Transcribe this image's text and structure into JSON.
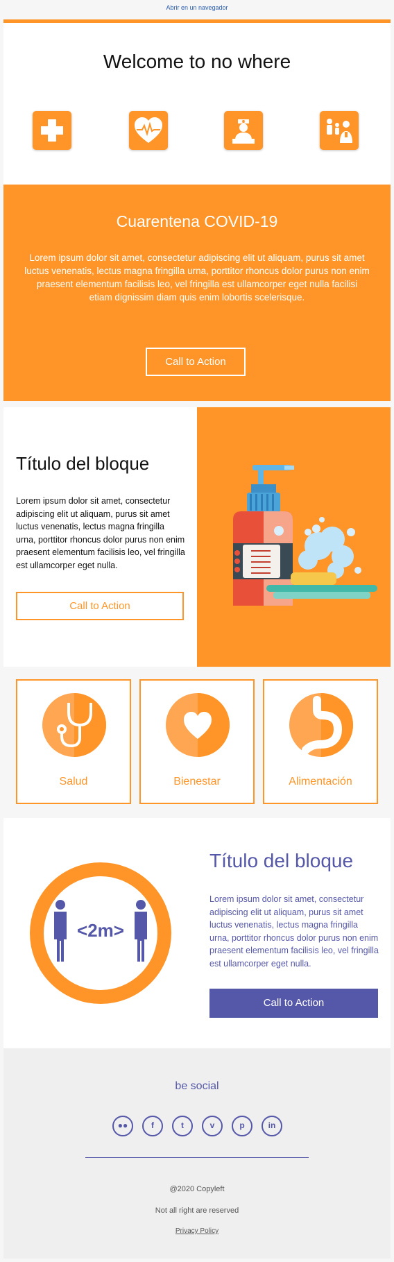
{
  "topbar": {
    "open_link": "Abrir en un navegador"
  },
  "header": {
    "title": "Welcome to no where",
    "icons": [
      "medical-cross-icon",
      "heart-pulse-icon",
      "nurse-icon",
      "family-doctor-icon"
    ]
  },
  "covid": {
    "title": "Cuarentena COVID-19",
    "body": "Lorem ipsum dolor sit amet, consectetur adipiscing elit ut aliquam, purus sit amet luctus venenatis, lectus magna fringilla urna, porttitor rhoncus dolor purus non enim praesent elementum facilisis leo, vel fringilla est ullamcorper eget nulla facilisi etiam dignissim diam quis enim lobortis scelerisque.",
    "cta": "Call to Action"
  },
  "block1": {
    "title": "Título del bloque",
    "body": "Lorem ipsum dolor sit amet, consectetur adipiscing elit ut aliquam, purus sit amet luctus venenatis, lectus magna fringilla urna, porttitor rhoncus dolor purus non enim praesent elementum facilisis leo, vel fringilla est ullamcorper eget nulla.",
    "cta": "Call to Action",
    "image": "soap-bottle-illustration"
  },
  "cards": [
    {
      "label": "Salud",
      "icon": "stethoscope-icon"
    },
    {
      "label": "Bienestar",
      "icon": "heart-icon"
    },
    {
      "label": "Alimentación",
      "icon": "stomach-icon"
    }
  ],
  "block2": {
    "title": "Título del bloque",
    "body": "Lorem ipsum dolor sit amet, consectetur adipiscing elit ut aliquam, purus sit amet luctus venenatis, lectus magna fringilla urna, porttitor rhoncus dolor purus non enim praesent elementum facilisis leo, vel fringilla est ullamcorper eget nulla.",
    "cta": "Call to Action",
    "badge_text": "<2m>"
  },
  "footer": {
    "social_title": "be social",
    "socials": [
      "flickr-icon",
      "facebook-icon",
      "twitter-icon",
      "vimeo-icon",
      "pinterest-icon",
      "linkedin-icon"
    ],
    "copyright": "@2020 Copyleft",
    "rights": "Not all right are reserved",
    "privacy": "Privacy Policy"
  },
  "colors": {
    "orange": "#ff9528",
    "purple": "#5557a8",
    "white": "#ffffff"
  }
}
